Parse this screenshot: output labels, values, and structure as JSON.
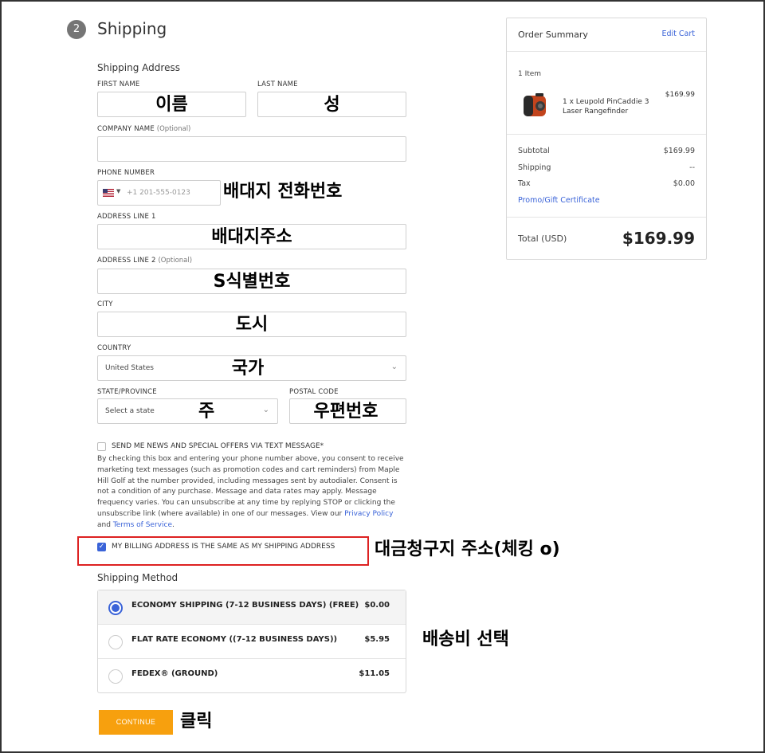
{
  "header": {
    "step_number": "2",
    "title": "Shipping"
  },
  "shipping_address": {
    "section_title": "Shipping Address",
    "first_name_label": "FIRST NAME",
    "last_name_label": "LAST NAME",
    "company_label": "COMPANY NAME",
    "optional_text": "(Optional)",
    "phone_label": "PHONE NUMBER",
    "phone_placeholder": "+1 201-555-0123",
    "address1_label": "ADDRESS LINE 1",
    "address2_label": "ADDRESS LINE 2",
    "city_label": "CITY",
    "country_label": "COUNTRY",
    "country_value": "United States",
    "state_label": "STATE/PROVINCE",
    "state_value": "Select a state",
    "postal_label": "POSTAL CODE"
  },
  "annotations": {
    "first_name": "이름",
    "last_name": "성",
    "phone": "배대지 전화번호",
    "address1": "배대지주소",
    "address2": "S식별번호",
    "city": "도시",
    "country": "국가",
    "state": "주",
    "postal": "우편번호",
    "billing": "대금청구지 주소(체킹 o)",
    "shipping_method": "배송비 선택",
    "continue": "클릭"
  },
  "sms_opt_in": {
    "label": "SEND ME NEWS AND SPECIAL OFFERS VIA TEXT MESSAGE*",
    "checked": false,
    "consent_text": "By checking this box and entering your phone number above, you consent to receive marketing text messages (such as promotion codes and cart reminders) from Maple Hill Golf at the number provided, including messages sent by autodialer. Consent is not a condition of any purchase. Message and data rates may apply. Message frequency varies. You can unsubscribe at any time by replying STOP or clicking the unsubscribe link (where available) in one of our messages. View our",
    "privacy_link": "Privacy Policy",
    "and_text": "and",
    "terms_link": "Terms of Service",
    "end_text": "."
  },
  "billing_same": {
    "label": "MY BILLING ADDRESS IS THE SAME AS MY SHIPPING ADDRESS",
    "checked": true
  },
  "shipping_method": {
    "title": "Shipping Method",
    "options": [
      {
        "name": "ECONOMY SHIPPING (7-12 BUSINESS DAYS) (FREE)",
        "price": "$0.00",
        "selected": true
      },
      {
        "name": "FLAT RATE ECONOMY ((7-12 BUSINESS DAYS))",
        "price": "$5.95",
        "selected": false
      },
      {
        "name": "FEDEX® (GROUND)",
        "price": "$11.05",
        "selected": false
      }
    ]
  },
  "continue_button": "CONTINUE",
  "order_summary": {
    "title": "Order Summary",
    "edit_cart": "Edit Cart",
    "item_count": "1 Item",
    "item_name": "1 x Leupold PinCaddie 3 Laser Rangefinder",
    "item_price": "$169.99",
    "subtotal_label": "Subtotal",
    "subtotal_value": "$169.99",
    "shipping_label": "Shipping",
    "shipping_value": "--",
    "tax_label": "Tax",
    "tax_value": "$0.00",
    "promo": "Promo/Gift Certificate",
    "total_label": "Total (USD)",
    "total_value": "$169.99"
  },
  "colors": {
    "accent": "#3a63d8",
    "button": "#f7a00e",
    "highlight_border": "#dd2222"
  },
  "icons": [
    "us-flag-icon",
    "chevron-down-icon",
    "checkmark-icon",
    "rangefinder-product-image"
  ]
}
